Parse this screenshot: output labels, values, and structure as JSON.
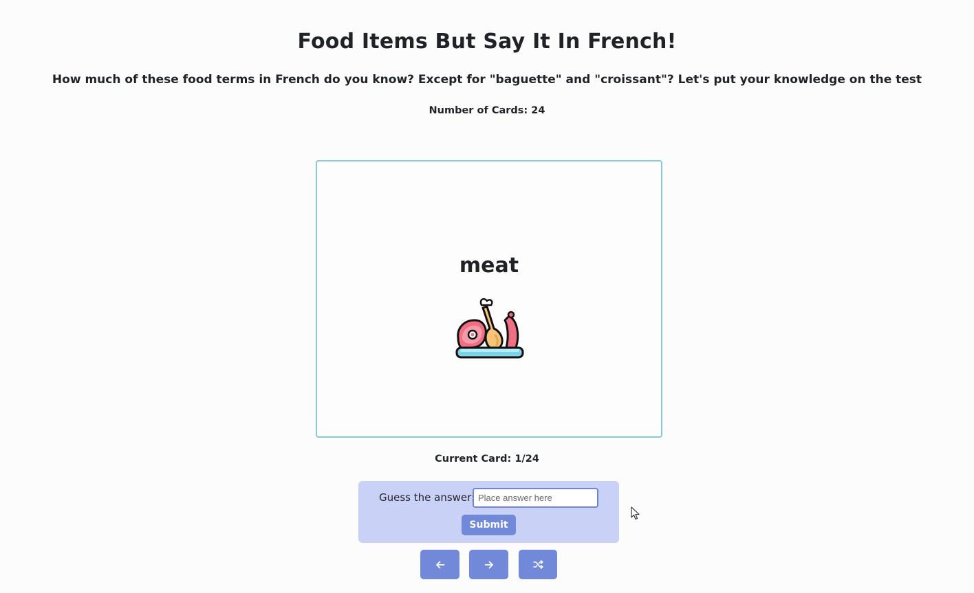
{
  "header": {
    "title": "Food Items But Say It In French!",
    "subtitle": "How much of these food terms in French do you know? Except for \"baguette\" and \"croissant\"? Let's put your knowledge on the test",
    "card_count": "Number of Cards: 24"
  },
  "card": {
    "word": "meat",
    "image_icon": "meat-platter-icon"
  },
  "progress": {
    "current": "Current Card: 1/24"
  },
  "guess": {
    "label": "Guess the answer:",
    "value": "",
    "placeholder": "Place answer here",
    "submit_label": "Submit"
  },
  "nav": {
    "prev_icon": "arrow-left-icon",
    "next_icon": "arrow-right-icon",
    "shuffle_icon": "shuffle-icon"
  },
  "colors": {
    "accent": "#7289da",
    "panel": "#c9d1f6",
    "card_border": "#8ac8de"
  }
}
